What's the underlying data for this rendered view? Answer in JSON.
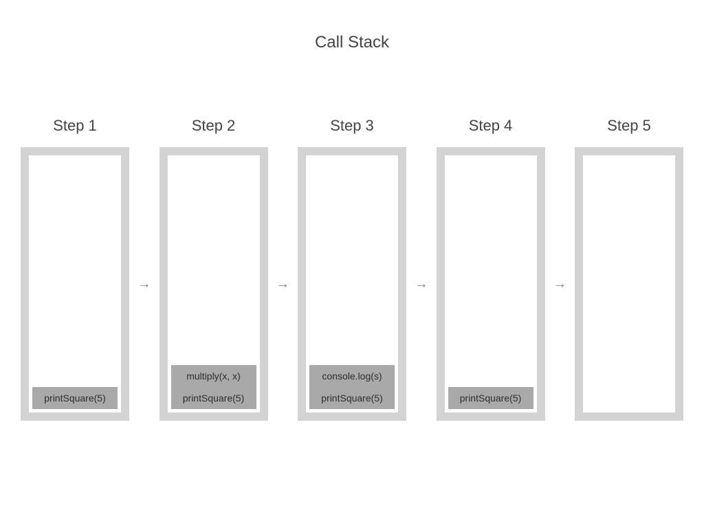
{
  "title": "Call Stack",
  "steps": [
    {
      "label": "Step 1",
      "frames": [
        "printSquare(5)"
      ]
    },
    {
      "label": "Step 2",
      "frames": [
        "printSquare(5)",
        "multiply(x, x)"
      ]
    },
    {
      "label": "Step 3",
      "frames": [
        "printSquare(5)",
        "console.log(s)"
      ]
    },
    {
      "label": "Step 4",
      "frames": [
        "printSquare(5)"
      ]
    },
    {
      "label": "Step 5",
      "frames": []
    }
  ],
  "arrow_glyph": "→"
}
